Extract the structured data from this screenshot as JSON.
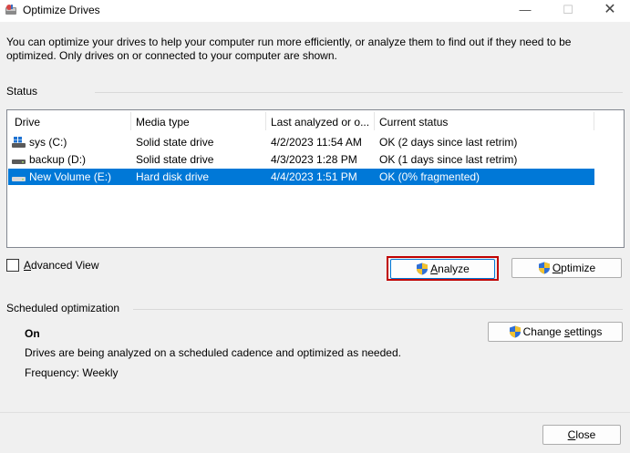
{
  "window": {
    "title": "Optimize Drives",
    "minimize_glyph": "—",
    "maximize_glyph": "☐",
    "close_glyph": "✕"
  },
  "description": "You can optimize your drives to help your computer run more efficiently, or analyze them to find out if they need to be optimized. Only drives on or connected to your computer are shown.",
  "status_section": {
    "label": "Status"
  },
  "drive_table": {
    "headers": [
      "Drive",
      "Media type",
      "Last analyzed or o...",
      "Current status"
    ],
    "rows": [
      {
        "drive": "sys (C:)",
        "media": "Solid state drive",
        "last": "4/2/2023 11:54 AM",
        "status": "OK (2 days since last retrim)",
        "icon": "system-drive-icon"
      },
      {
        "drive": "backup (D:)",
        "media": "Solid state drive",
        "last": "4/3/2023 1:28 PM",
        "status": "OK (1 days since last retrim)",
        "icon": "drive-icon"
      },
      {
        "drive": "New Volume (E:)",
        "media": "Hard disk drive",
        "last": "4/4/2023 1:51 PM",
        "status": "OK (0% fragmented)",
        "icon": "drive-icon",
        "selected": true
      }
    ]
  },
  "advanced_view": {
    "label_prefix": "",
    "label_access": "A",
    "label_rest": "dvanced View",
    "checked": false
  },
  "buttons": {
    "analyze": {
      "access": "A",
      "rest": "nalyze"
    },
    "optimize": {
      "access": "O",
      "rest": "ptimize"
    },
    "change_settings": {
      "prefix": "Change ",
      "access": "s",
      "rest": "ettings"
    },
    "close": {
      "access": "C",
      "rest": "lose"
    }
  },
  "schedule": {
    "label": "Scheduled optimization",
    "state": "On",
    "description": "Drives are being analyzed on a scheduled cadence and optimized as needed.",
    "frequency": "Frequency: Weekly"
  },
  "colors": {
    "selection": "#0078d7",
    "highlight_box": "#c00000",
    "accent": "#0078d7"
  }
}
